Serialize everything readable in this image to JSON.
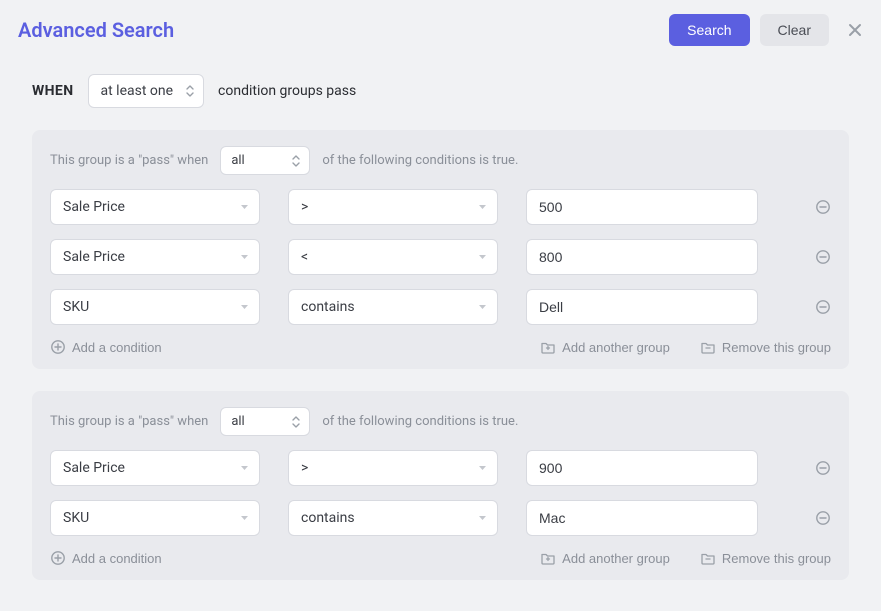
{
  "header": {
    "title": "Advanced Search",
    "search_label": "Search",
    "clear_label": "Clear"
  },
  "when": {
    "label": "WHEN",
    "mode": "at least one",
    "suffix": "condition groups pass"
  },
  "group_text": {
    "prefix": "This group is a \"pass\" when",
    "suffix": "of the following conditions is true.",
    "add_condition": "Add a condition",
    "add_group": "Add another group",
    "remove_group": "Remove this group"
  },
  "groups": [
    {
      "mode": "all",
      "conditions": [
        {
          "field": "Sale Price",
          "operator": ">",
          "value": "500"
        },
        {
          "field": "Sale Price",
          "operator": "<",
          "value": "800"
        },
        {
          "field": "SKU",
          "operator": "contains",
          "value": "Dell"
        }
      ]
    },
    {
      "mode": "all",
      "conditions": [
        {
          "field": "Sale Price",
          "operator": ">",
          "value": "900"
        },
        {
          "field": "SKU",
          "operator": "contains",
          "value": "Mac"
        }
      ]
    }
  ]
}
